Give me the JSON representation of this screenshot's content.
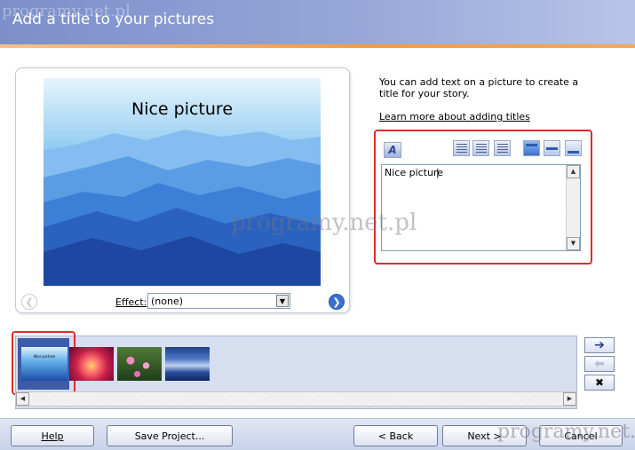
{
  "header": {
    "title": "Add a title to your pictures"
  },
  "preview": {
    "caption": "Nice picture",
    "effect_label": "Effect:",
    "effect_value": "(none)"
  },
  "info": {
    "instructions": "You can add text on a picture to create a title for your story.",
    "learn_more": "Learn more about adding titles"
  },
  "editor": {
    "text_value": "Nice picture"
  },
  "thumbnails": [
    {
      "name": "mountains",
      "title": "Nice picture",
      "selected": true
    },
    {
      "name": "sunset"
    },
    {
      "name": "flowers"
    },
    {
      "name": "clouds"
    }
  ],
  "footer": {
    "help": "Help",
    "save": "Save Project...",
    "back": "< Back",
    "next": "Next >",
    "cancel": "Cancel"
  },
  "watermark": "programy.net.pl",
  "colors": {
    "highlight": "#e12b2b",
    "accent": "#3a6fce"
  }
}
